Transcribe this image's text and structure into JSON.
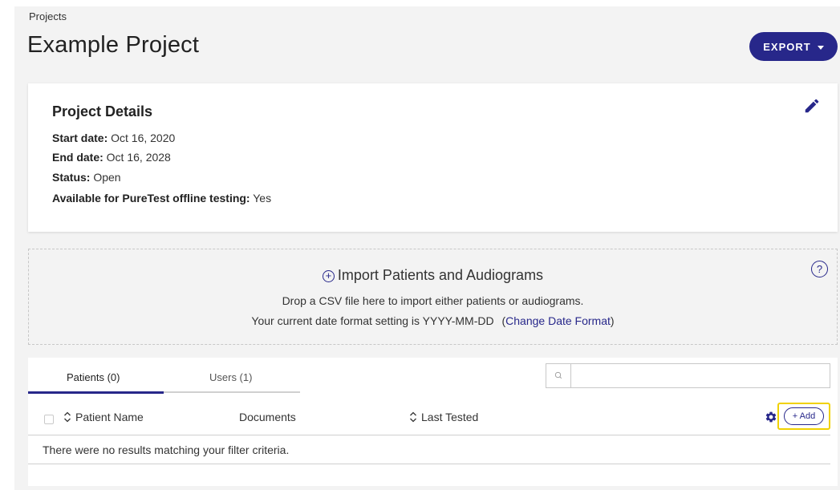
{
  "breadcrumb": "Projects",
  "page_title": "Example Project",
  "export_label": "EXPORT",
  "details": {
    "title": "Project Details",
    "start_key": "Start date:",
    "start_val": "Oct 16, 2020",
    "end_key": "End date:",
    "end_val": "Oct 16, 2028",
    "status_key": "Status:",
    "status_val": "Open",
    "offline_key": "Available for PureTest offline testing:",
    "offline_val": "Yes"
  },
  "import": {
    "plus_glyph": "+",
    "title": "Import Patients and Audiograms",
    "line1": "Drop a CSV file here to import either patients or audiograms.",
    "line2_prefix": "Your current date format setting is YYYY-MM-DD",
    "link_open": "(",
    "link_text": "Change Date Format",
    "link_close": ")",
    "help_glyph": "?"
  },
  "tabs": {
    "patients": "Patients (0)",
    "users": "Users (1)"
  },
  "search": {
    "value": "",
    "placeholder": ""
  },
  "table": {
    "col_name": "Patient Name",
    "col_docs": "Documents",
    "col_tested": "Last Tested",
    "add_label": "+ Add",
    "empty_message": "There were no results matching your filter criteria."
  },
  "colors": {
    "accent": "#27278a",
    "highlight": "#f0d100",
    "background": "#f3f3f3"
  }
}
